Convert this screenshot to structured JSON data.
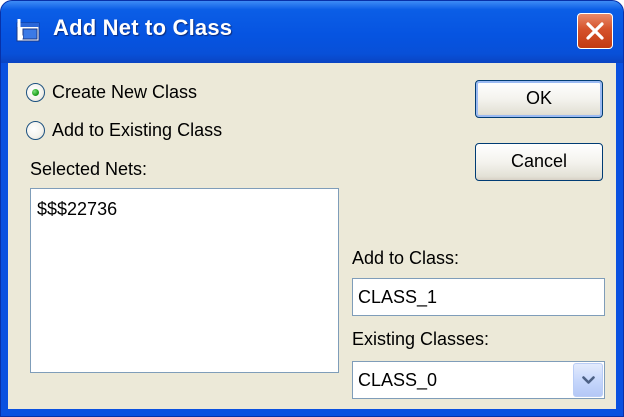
{
  "window": {
    "title": "Add Net to Class",
    "colors": {
      "titlebar": "#0654e1",
      "client": "#ece9d8",
      "close": "#d5522b"
    }
  },
  "options": {
    "create_new": {
      "label": "Create New Class",
      "checked": true
    },
    "add_existing": {
      "label": "Add to Existing Class",
      "checked": false
    }
  },
  "nets": {
    "label": "Selected Nets:",
    "items": [
      "$$$22736"
    ]
  },
  "buttons": {
    "ok": "OK",
    "cancel": "Cancel"
  },
  "add_to_class": {
    "label": "Add to Class:",
    "value": "CLASS_1"
  },
  "existing_classes": {
    "label": "Existing Classes:",
    "selected": "CLASS_0"
  },
  "icons": {
    "app": "app-window-icon",
    "close": "close-icon",
    "dropdown": "chevron-down-icon"
  }
}
